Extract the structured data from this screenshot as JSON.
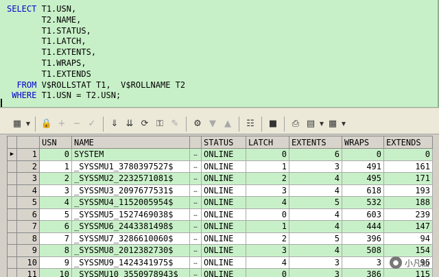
{
  "editor": {
    "lines": [
      "SELECT T1.USN,",
      "       T2.NAME,",
      "       T1.STATUS,",
      "       T1.LATCH,",
      "       T1.EXTENTS,",
      "       T1.WRAPS,",
      "       T1.EXTENDS",
      "  FROM V$ROLLSTAT T1,  V$ROLLNAME T2",
      " WHERE T1.USN = T2.USN;"
    ]
  },
  "toolbar": {
    "icons": [
      "grid-icon",
      "lock-icon",
      "plus-icon",
      "minus-icon",
      "check-icon",
      "arrow-down-icon",
      "arrow-down-all-icon",
      "refresh-icon",
      "find-icon",
      "clear-icon",
      "query-icon",
      "triangle-down-icon",
      "triangle-up-icon",
      "link-icon",
      "save-icon",
      "print-icon",
      "chart-icon",
      "export-icon"
    ]
  },
  "grid": {
    "columns": [
      "",
      "USN",
      "NAME",
      "",
      "STATUS",
      "LATCH",
      "EXTENTS",
      "WRAPS",
      "EXTENDS"
    ],
    "rows": [
      {
        "rn": "1",
        "usn": "0",
        "name": "SYSTEM",
        "status": "ONLINE",
        "latch": "0",
        "extents": "6",
        "wraps": "0",
        "extends": "0"
      },
      {
        "rn": "2",
        "usn": "1",
        "name": "_SYSSMU1_3780397527$",
        "status": "ONLINE",
        "latch": "1",
        "extents": "3",
        "wraps": "491",
        "extends": "161"
      },
      {
        "rn": "3",
        "usn": "2",
        "name": "_SYSSMU2_2232571081$",
        "status": "ONLINE",
        "latch": "2",
        "extents": "4",
        "wraps": "495",
        "extends": "171"
      },
      {
        "rn": "4",
        "usn": "3",
        "name": "_SYSSMU3_2097677531$",
        "status": "ONLINE",
        "latch": "3",
        "extents": "4",
        "wraps": "618",
        "extends": "193"
      },
      {
        "rn": "5",
        "usn": "4",
        "name": "_SYSSMU4_1152005954$",
        "status": "ONLINE",
        "latch": "4",
        "extents": "5",
        "wraps": "532",
        "extends": "188"
      },
      {
        "rn": "6",
        "usn": "5",
        "name": "_SYSSMU5_1527469038$",
        "status": "ONLINE",
        "latch": "0",
        "extents": "4",
        "wraps": "603",
        "extends": "239"
      },
      {
        "rn": "7",
        "usn": "6",
        "name": "_SYSSMU6_2443381498$",
        "status": "ONLINE",
        "latch": "1",
        "extents": "4",
        "wraps": "444",
        "extends": "147"
      },
      {
        "rn": "8",
        "usn": "7",
        "name": "_SYSSMU7_3286610060$",
        "status": "ONLINE",
        "latch": "2",
        "extents": "5",
        "wraps": "396",
        "extends": "94"
      },
      {
        "rn": "9",
        "usn": "8",
        "name": "_SYSSMU8_2012382730$",
        "status": "ONLINE",
        "latch": "3",
        "extents": "4",
        "wraps": "508",
        "extends": "154"
      },
      {
        "rn": "10",
        "usn": "9",
        "name": "_SYSSMU9_1424341975$",
        "status": "ONLINE",
        "latch": "4",
        "extents": "3",
        "wraps": "3",
        "extends": "96"
      },
      {
        "rn": "11",
        "usn": "10",
        "name": "_SYSSMU10_3550978943$",
        "status": "ONLINE",
        "latch": "0",
        "extents": "3",
        "wraps": "386",
        "extends": "115"
      }
    ]
  },
  "watermark": {
    "text": "小凡仙"
  }
}
